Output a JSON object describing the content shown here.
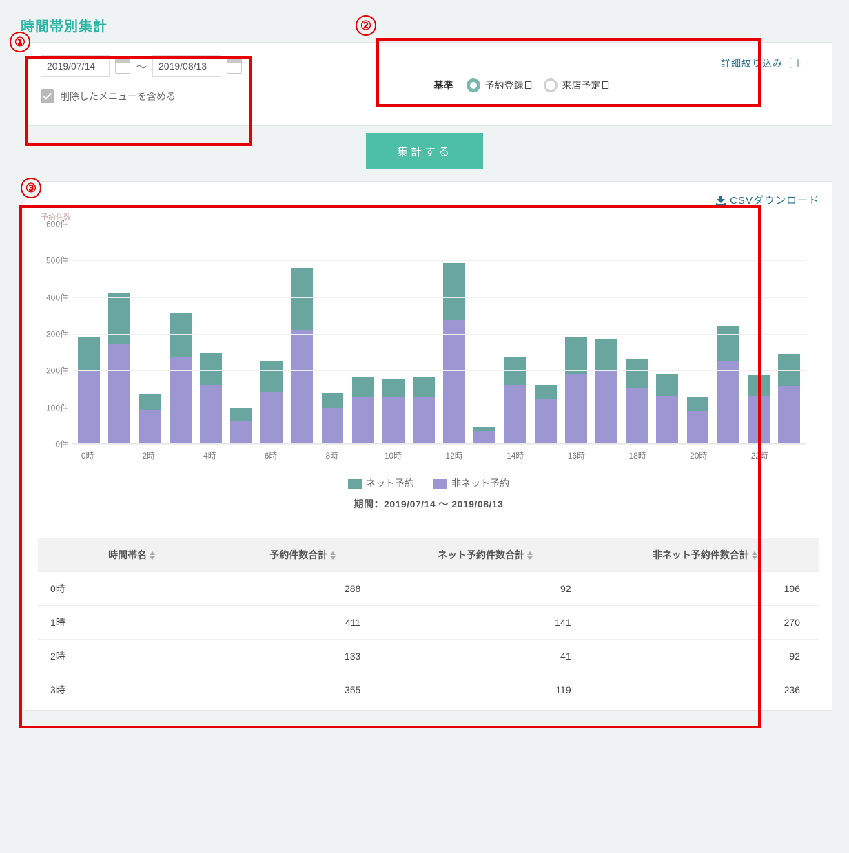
{
  "title": "時間帯別集計",
  "filters": {
    "date_from": "2019/07/14",
    "date_to": "2019/08/13",
    "range_separator": "〜",
    "include_deleted_label": "削除したメニューを含める",
    "include_deleted_checked": true,
    "advanced_link": "詳細絞り込み［＋］",
    "basis_label": "基準",
    "basis_options": [
      {
        "label": "予約登録日",
        "selected": true
      },
      {
        "label": "来店予定日",
        "selected": false
      }
    ]
  },
  "aggregate_button": "集計する",
  "csv_download": "CSVダウンロード",
  "period_line": "期間：2019/07/14 〜 2019/08/13",
  "legend": {
    "net": "ネット予約",
    "non": "非ネット予約"
  },
  "chart_data": {
    "type": "bar",
    "title": "",
    "ylabel": "予約件数",
    "ylim": [
      0,
      600
    ],
    "ytick_suffix": "件",
    "xtick_suffix": "時",
    "xtick_step": 2,
    "categories": [
      "0時",
      "1時",
      "2時",
      "3時",
      "4時",
      "5時",
      "6時",
      "7時",
      "8時",
      "9時",
      "10時",
      "11時",
      "12時",
      "13時",
      "14時",
      "15時",
      "16時",
      "17時",
      "18時",
      "19時",
      "20時",
      "21時",
      "22時",
      "23時"
    ],
    "series": [
      {
        "name": "非ネット予約",
        "color": "#9c97d3",
        "values": [
          196,
          270,
          92,
          236,
          160,
          60,
          140,
          310,
          95,
          125,
          125,
          125,
          335,
          33,
          160,
          120,
          190,
          200,
          150,
          130,
          88,
          225,
          130,
          155
        ]
      },
      {
        "name": "ネット予約",
        "color": "#6aa6a0",
        "values": [
          92,
          141,
          41,
          119,
          85,
          38,
          85,
          166,
          42,
          55,
          50,
          55,
          156,
          12,
          75,
          40,
          100,
          85,
          80,
          60,
          40,
          95,
          55,
          88
        ]
      }
    ],
    "totals": [
      288,
      411,
      133,
      355,
      245,
      98,
      225,
      476,
      137,
      180,
      175,
      180,
      491,
      45,
      235,
      160,
      290,
      285,
      230,
      190,
      128,
      320,
      185,
      243
    ]
  },
  "table": {
    "headers": [
      "時間帯名",
      "予約件数合計",
      "ネット予約件数合計",
      "非ネット予約件数合計"
    ],
    "rows": [
      {
        "name": "0時",
        "total": 288,
        "net": 92,
        "non": 196
      },
      {
        "name": "1時",
        "total": 411,
        "net": 141,
        "non": 270
      },
      {
        "name": "2時",
        "total": 133,
        "net": 41,
        "non": 92
      },
      {
        "name": "3時",
        "total": 355,
        "net": 119,
        "non": 236
      }
    ]
  },
  "markers": {
    "m1": "①",
    "m2": "②",
    "m3": "③"
  }
}
